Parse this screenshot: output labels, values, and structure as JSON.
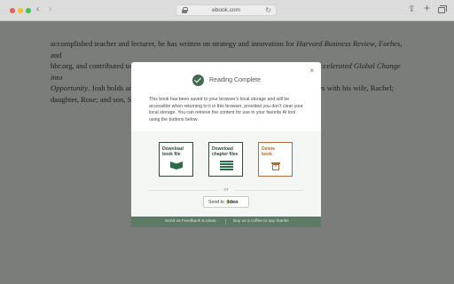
{
  "browser": {
    "url": "ebook.com",
    "back_symbol": "‹",
    "forward_symbol": "›",
    "reload_symbol": "↻",
    "share_symbol": "⇪",
    "new_tab_symbol": "+"
  },
  "article": {
    "line1_a": "accomplished teacher and lecturer, he has written on strategy and innovation for ",
    "line1_i": "Harvard Business Review",
    "line1_b": ", ",
    "line1_i2": "Forbes",
    "line1_c": ", and",
    "line2_a": "hbr.org, and contributed to the business textbook ",
    "line2_i": "From Strategy to Execution: Turning Accelerated Global Change into",
    "line3_i": "Opportunity",
    "line3_a": ". Josh holds an",
    "line3_b": "ives with his wife, Rachel;",
    "line4_a": "daughter, Rose; and son, Sa"
  },
  "modal": {
    "close_symbol": "×",
    "title": "Reading Complete",
    "description": "This book has been saved to your browser's local storage and will be accessible when returning to it in this browser, provided you don't clear your local storage. You can retrieve the content for use in your favorite AI tool using the buttons below.",
    "download_book_line1": "Download",
    "download_book_line2": "book file",
    "download_chapters_line1": "Download",
    "download_chapters_line2": "chapter files",
    "delete_line1": "Delete",
    "delete_line2": "book",
    "or_label": "or",
    "send_label": "Send to",
    "send_brand": "ideo",
    "footer_feedback": "Send us Feedback & Ideas",
    "footer_coffee": "Buy us a coffee to say thanks"
  },
  "colors": {
    "accent_green": "#436b53",
    "delete_orange": "#b06a3a",
    "footer_green": "#5c7a66"
  }
}
